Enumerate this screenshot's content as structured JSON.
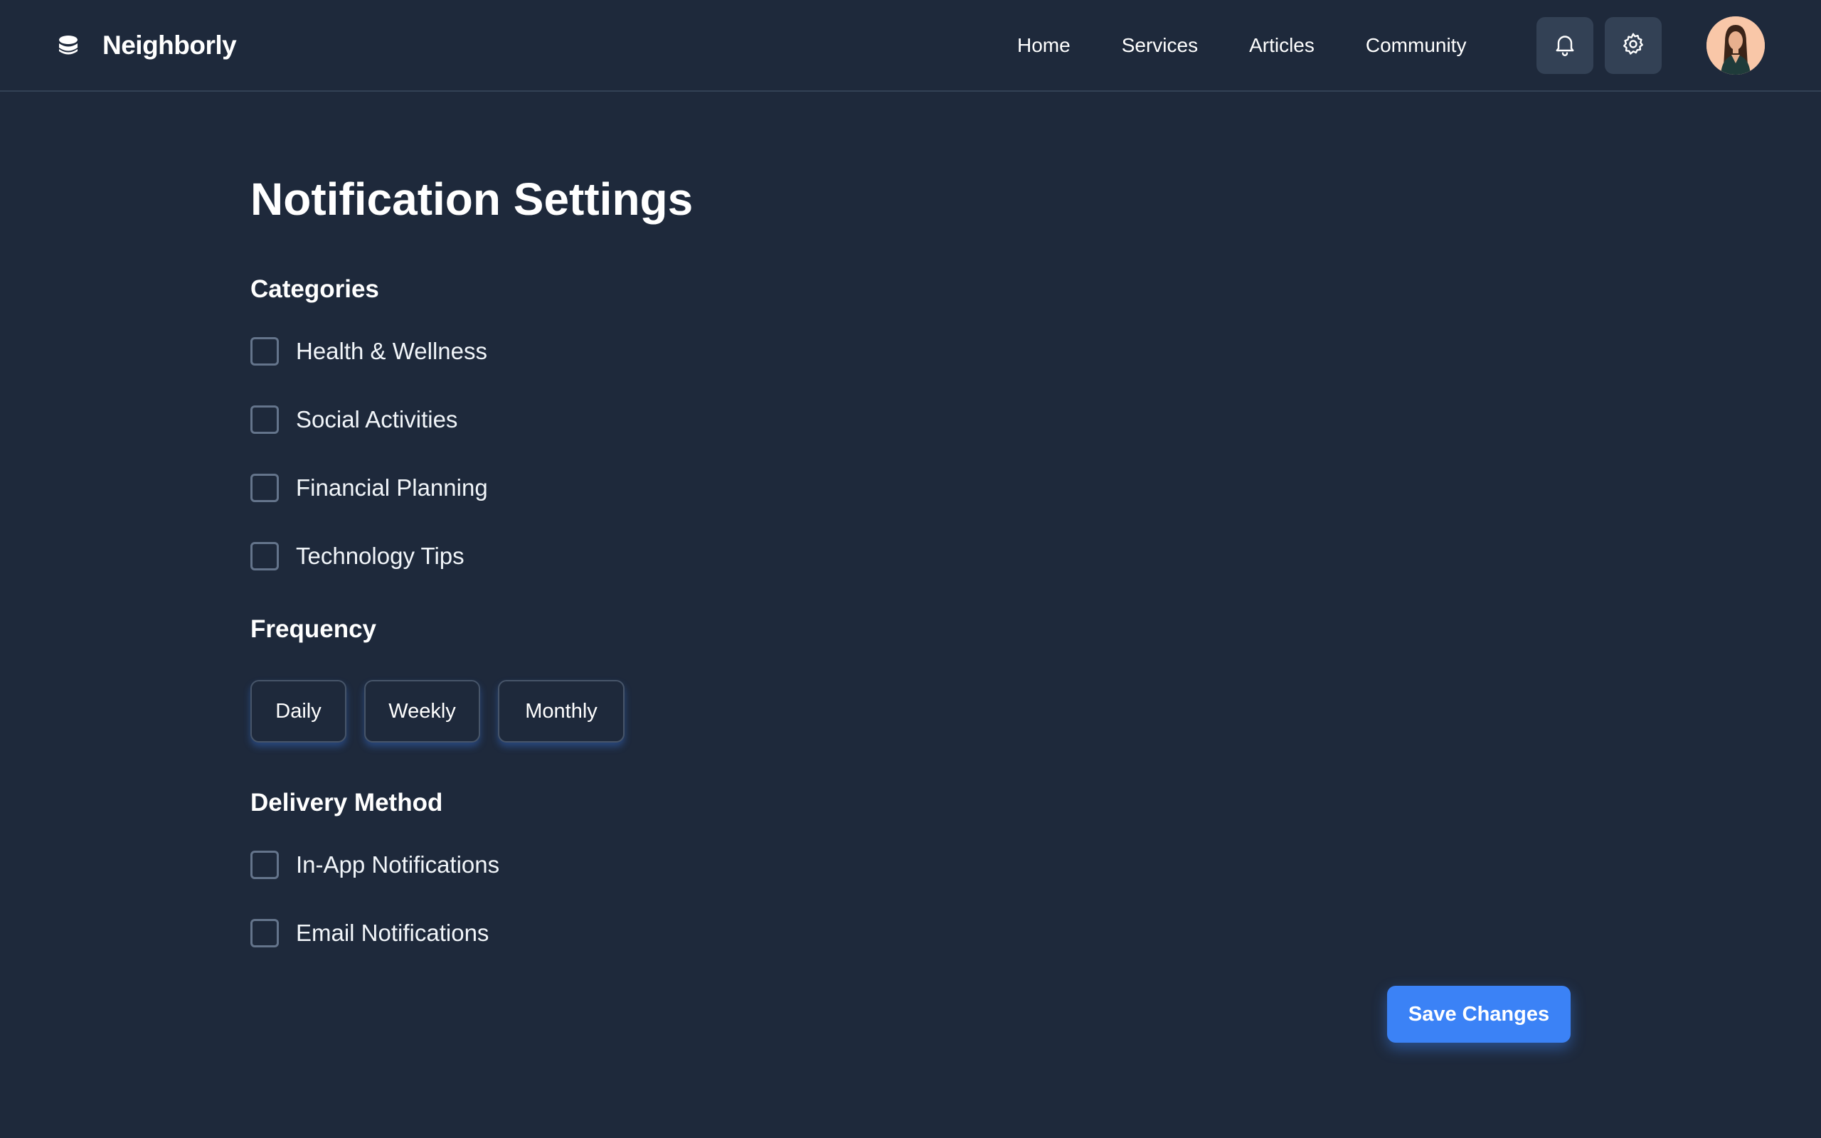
{
  "header": {
    "brand_name": "Neighborly",
    "nav": [
      "Home",
      "Services",
      "Articles",
      "Community"
    ]
  },
  "page": {
    "title": "Notification Settings"
  },
  "categories": {
    "title": "Categories",
    "items": [
      {
        "label": "Health & Wellness",
        "checked": false
      },
      {
        "label": "Social Activities",
        "checked": false
      },
      {
        "label": "Financial Planning",
        "checked": false
      },
      {
        "label": "Technology Tips",
        "checked": false
      }
    ]
  },
  "frequency": {
    "title": "Frequency",
    "options": [
      "Daily",
      "Weekly",
      "Monthly"
    ]
  },
  "delivery": {
    "title": "Delivery Method",
    "items": [
      {
        "label": "In-App Notifications",
        "checked": false
      },
      {
        "label": "Email Notifications",
        "checked": false
      }
    ]
  },
  "actions": {
    "save_label": "Save Changes"
  },
  "colors": {
    "background": "#1e293b",
    "accent": "#3b82f6",
    "icon_button": "#334155"
  },
  "icons": {
    "brand": "stack-logo-icon",
    "notifications": "bell-icon",
    "settings": "gear-icon"
  }
}
